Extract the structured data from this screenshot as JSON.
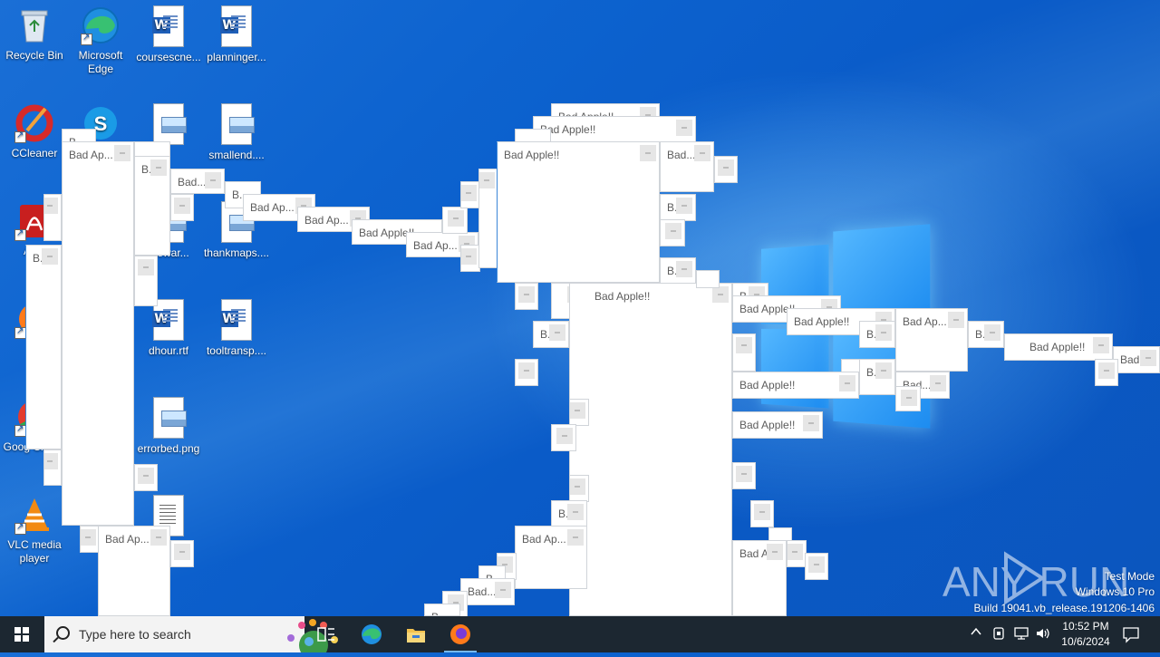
{
  "desktop": {
    "icons": [
      {
        "label": "Recycle Bin",
        "icon": "recycle-bin-icon"
      },
      {
        "label": "Microsoft Edge",
        "icon": "edge-icon"
      },
      {
        "label": "coursescne...",
        "icon": "word-doc-icon"
      },
      {
        "label": "planninger...",
        "icon": "word-doc-icon"
      },
      {
        "label": "CCleaner",
        "icon": "ccleaner-icon"
      },
      {
        "label": "smallend....",
        "icon": "image-file-icon"
      },
      {
        "label": "thankmaps....",
        "icon": "image-file-icon"
      },
      {
        "label": "dhour.rtf",
        "icon": "word-doc-icon"
      },
      {
        "label": "tooltransp....",
        "icon": "word-doc-icon"
      },
      {
        "label": "errorbed.png",
        "icon": "image-file-icon"
      },
      {
        "label": "VLC media player",
        "icon": "vlc-icon"
      },
      {
        "label": "Goog Chrom",
        "icon": "chrome-icon"
      },
      {
        "label": "Fi",
        "icon": "firefox-icon"
      },
      {
        "label": "A Ac",
        "icon": "acrobat-icon"
      },
      {
        "label": "...ewar...",
        "icon": "file-icon"
      }
    ]
  },
  "windows": {
    "titles": {
      "full": "Bad Apple!!",
      "ap": "Bad Ap...",
      "bad": "Bad...",
      "b": "B...",
      "bad_ap_short": "Bad Ap",
      "bad_dot": "Bad..."
    }
  },
  "taskbar": {
    "search_placeholder": "Type here to search",
    "apps": [
      "task-view-icon",
      "edge-icon",
      "file-explorer-icon",
      "firefox-icon"
    ],
    "time": "10:52 PM",
    "date": "10/6/2024"
  },
  "watermark": {
    "line1": "Test Mode",
    "line2": "Windows 10 Pro",
    "line3": "Build 19041.vb_release.191206-1406",
    "brand": "ANY RUN"
  }
}
